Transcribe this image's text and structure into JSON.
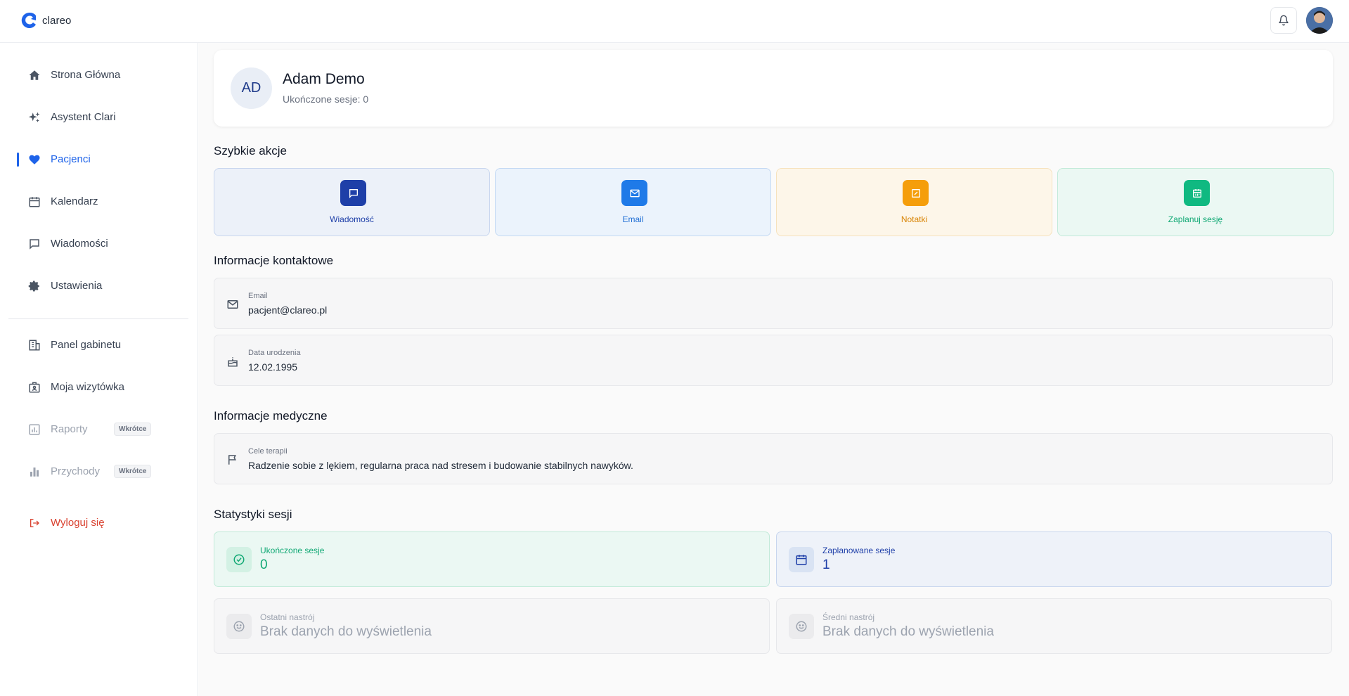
{
  "app": {
    "brand": "clareo"
  },
  "sidebar": {
    "items": [
      {
        "label": "Strona Główna",
        "icon": "home-icon"
      },
      {
        "label": "Asystent Clari",
        "icon": "sparkles-icon"
      },
      {
        "label": "Pacjenci",
        "icon": "heart-icon",
        "active": true
      },
      {
        "label": "Kalendarz",
        "icon": "calendar-icon"
      },
      {
        "label": "Wiadomości",
        "icon": "message-icon"
      },
      {
        "label": "Ustawienia",
        "icon": "gear-icon"
      }
    ],
    "secondary": [
      {
        "label": "Panel gabinetu",
        "icon": "building-icon"
      },
      {
        "label": "Moja wizytówka",
        "icon": "id-card-icon"
      },
      {
        "label": "Raporty",
        "icon": "report-icon",
        "badge": "Wkrótce"
      },
      {
        "label": "Przychody",
        "icon": "bar-chart-icon",
        "badge": "Wkrótce"
      }
    ],
    "logout": "Wyloguj się"
  },
  "profile": {
    "initials": "AD",
    "name": "Adam Demo",
    "completed_sessions": "Ukończone sesje: 0"
  },
  "quick_actions": {
    "title": "Szybkie akcje",
    "items": [
      {
        "label": "Wiadomość",
        "icon": "message-icon"
      },
      {
        "label": "Email",
        "icon": "mail-icon"
      },
      {
        "label": "Notatki",
        "icon": "edit-icon"
      },
      {
        "label": "Zaplanuj sesję",
        "icon": "calendar-icon"
      }
    ]
  },
  "contact": {
    "title": "Informacje kontaktowe",
    "email_label": "Email",
    "email_value": "pacjent@clareo.pl",
    "birth_label": "Data urodzenia",
    "birth_value": "12.02.1995"
  },
  "medical": {
    "title": "Informacje medyczne",
    "goals_label": "Cele terapii",
    "goals_value": "Radzenie sobie z lękiem, regularna praca nad stresem i budowanie stabilnych nawyków."
  },
  "stats": {
    "title": "Statystyki sesji",
    "completed_label": "Ukończone sesje",
    "completed_value": "0",
    "planned_label": "Zaplanowane sesje",
    "planned_value": "1",
    "last_mood_label": "Ostatni nastrój",
    "last_mood_value": "Brak danych do wyświetlenia",
    "avg_mood_label": "Średni nastrój",
    "avg_mood_value": "Brak danych do wyświetlenia"
  },
  "colors": {
    "accent": "#1e63e9",
    "message": "#1e3fa8",
    "email": "#1f7ae8",
    "notes": "#f59e0b",
    "schedule": "#10b981",
    "logout": "#d9412f"
  }
}
